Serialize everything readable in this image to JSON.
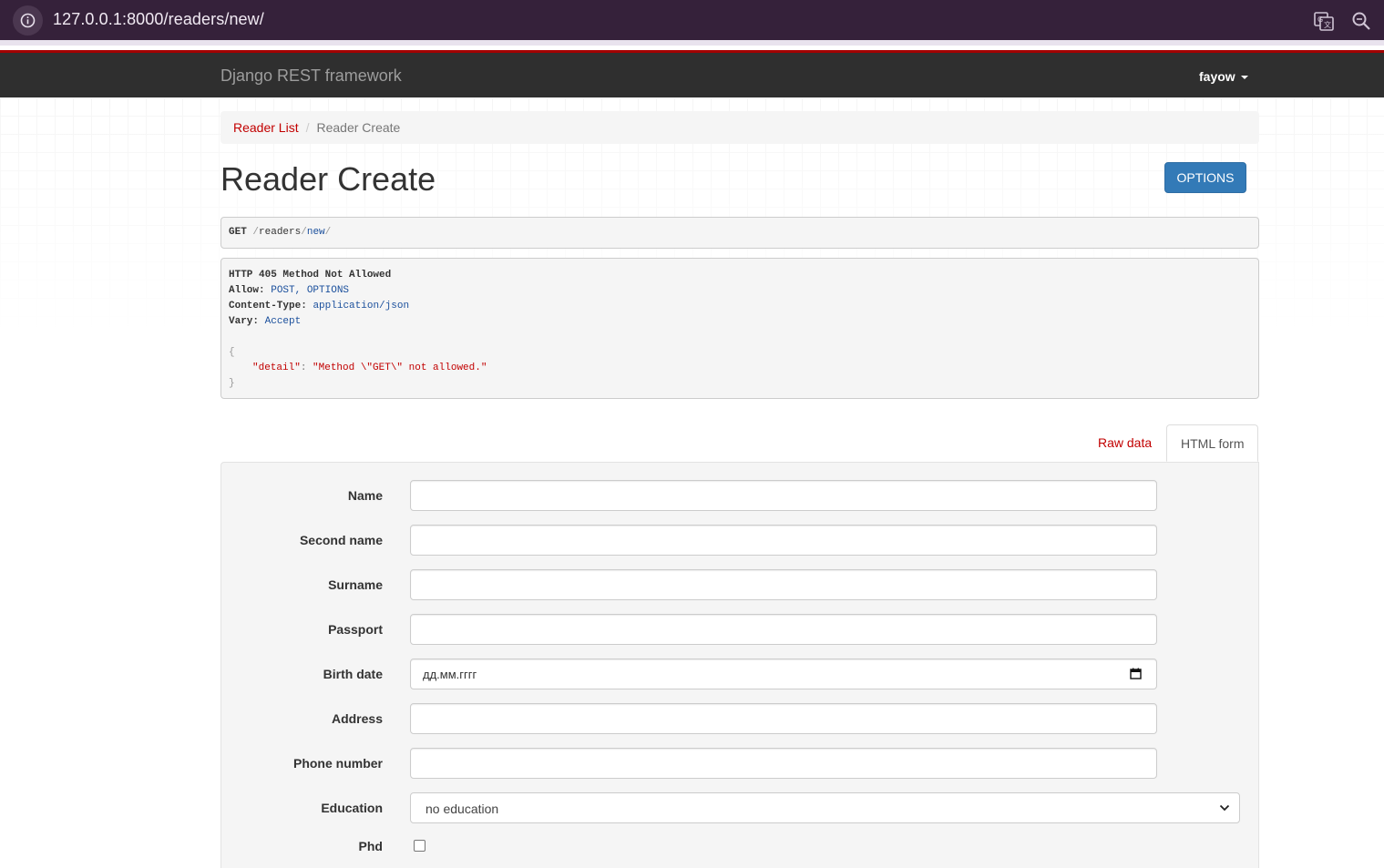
{
  "browser": {
    "url": "127.0.0.1:8000/readers/new/"
  },
  "navbar": {
    "brand": "Django REST framework",
    "user": "fayow"
  },
  "breadcrumb": {
    "parent": "Reader List",
    "separator": "/",
    "current": "Reader Create"
  },
  "page": {
    "title": "Reader Create",
    "options_button": "OPTIONS"
  },
  "request": {
    "method": "GET",
    "path_readers": "readers",
    "path_new": "new"
  },
  "response": {
    "status_line": "HTTP 405 Method Not Allowed",
    "allow_label": "Allow:",
    "allow_value": "POST, OPTIONS",
    "content_type_label": "Content-Type:",
    "content_type_value": "application/json",
    "vary_label": "Vary:",
    "vary_value": "Accept",
    "json_open": "{",
    "json_key": "\"detail\"",
    "json_value": "\"Method \\\"GET\\\" not allowed.\"",
    "json_close": "}"
  },
  "tabs": {
    "raw": "Raw data",
    "html": "HTML form"
  },
  "form": {
    "name_label": "Name",
    "second_name_label": "Second name",
    "surname_label": "Surname",
    "passport_label": "Passport",
    "birth_date_label": "Birth date",
    "birth_date_placeholder": "дд.мм.гггг",
    "address_label": "Address",
    "phone_label": "Phone number",
    "education_label": "Education",
    "education_value": "no education",
    "phd_label": "Phd"
  },
  "colors": {
    "accent_red": "#a30000",
    "link_red": "#c20000",
    "options_blue": "#337ab7",
    "navbar": "#2f2f2f",
    "browser_chrome": "#35213a"
  }
}
